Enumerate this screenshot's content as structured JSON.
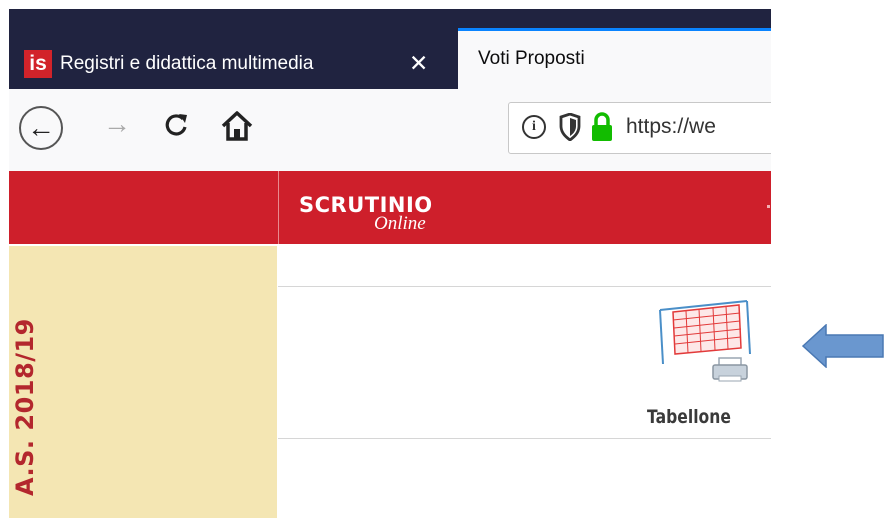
{
  "browser": {
    "tabs": [
      {
        "label": "Registri e didattica multimedia",
        "favicon_text": "is",
        "active": false
      },
      {
        "label": "Voti Proposti",
        "active": true
      }
    ],
    "close_glyph": "✕",
    "nav": {
      "back_glyph": "←",
      "forward_glyph": "→",
      "reload_glyph": "C"
    },
    "url": "https://we",
    "icons": [
      "back-icon",
      "forward-icon",
      "reload-icon",
      "home-icon",
      "info-icon",
      "shield-icon",
      "lock-icon"
    ]
  },
  "app": {
    "logo": {
      "main": "SCRUTINIO",
      "sub": "Online"
    },
    "sidebar": {
      "year": "A.S. 2018/19"
    },
    "content": {
      "items": [
        {
          "label": "Tabellone",
          "icon": "tabellone-icon"
        }
      ]
    }
  },
  "annotation": {
    "icon": "arrow-left-icon",
    "color": "#6a97cf"
  },
  "colors": {
    "tabstrip": "#202340",
    "tab_accent": "#0a84ff",
    "header_red": "#ce1f2b",
    "sidebar_bg": "#f4e6b3",
    "sidebar_text": "#b3272d",
    "lock_green": "#12bc00"
  }
}
